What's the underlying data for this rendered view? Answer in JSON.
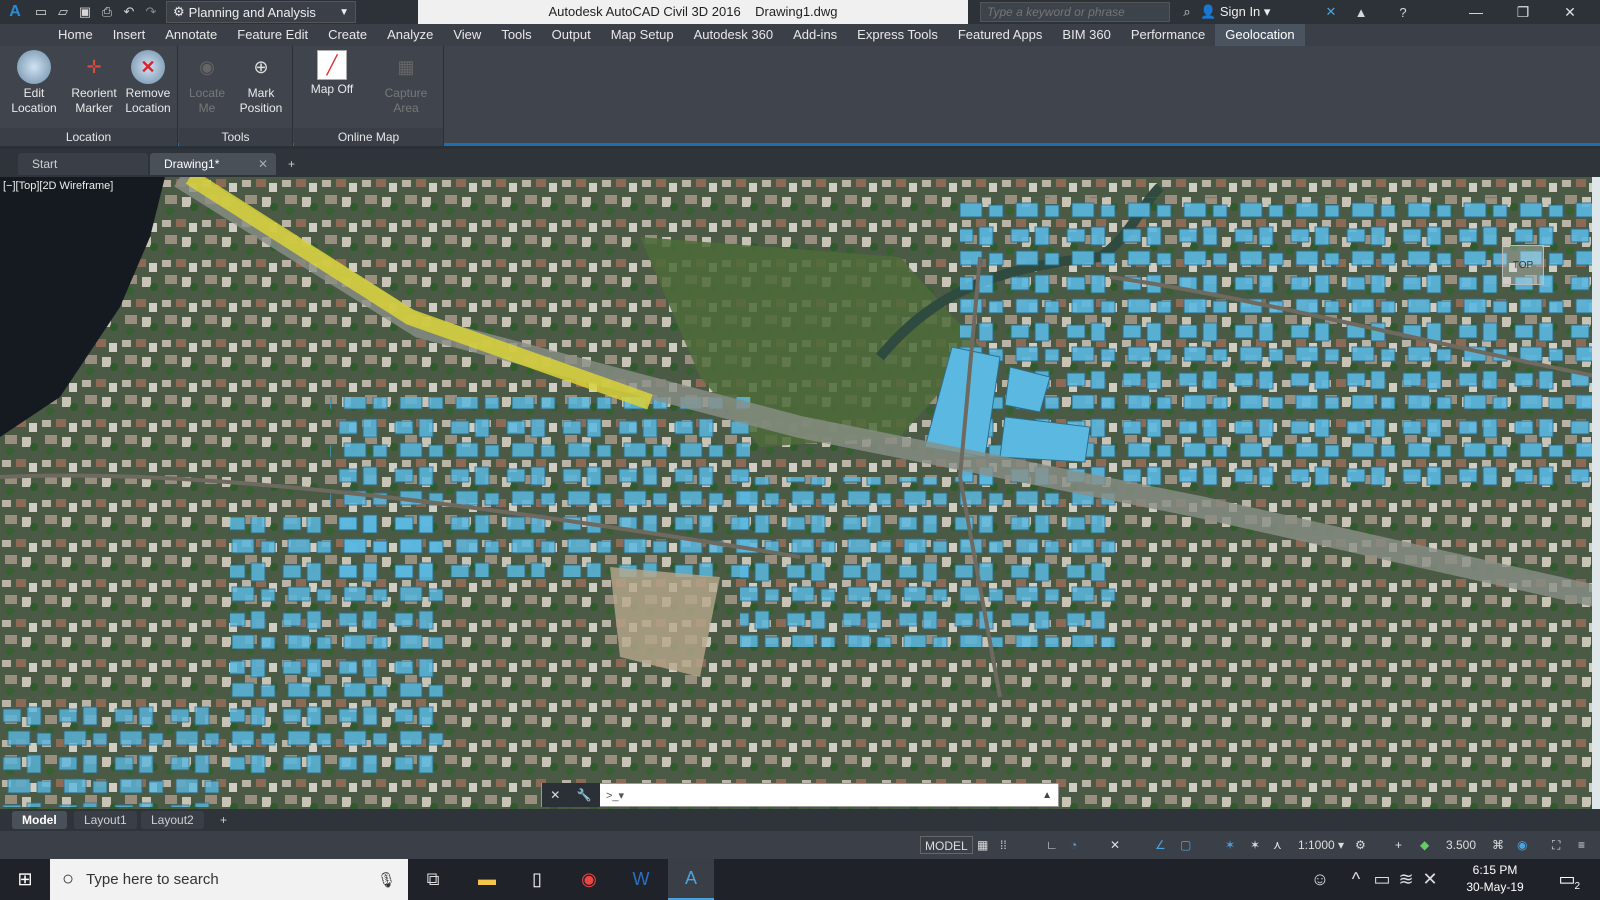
{
  "titlebar": {
    "app_icon": "autocad-logo-icon",
    "workspace": "Planning and Analysis",
    "title": "Autodesk AutoCAD Civil 3D 2016    Drawing1.dwg",
    "search_placeholder": "Type a keyword or phrase",
    "sign_in": "Sign In"
  },
  "menu": {
    "tabs": [
      "Home",
      "Insert",
      "Annotate",
      "Feature Edit",
      "Create",
      "Analyze",
      "View",
      "Tools",
      "Output",
      "Map Setup",
      "Autodesk 360",
      "Add-ins",
      "Express Tools",
      "Featured Apps",
      "BIM 360",
      "Performance",
      "Geolocation"
    ],
    "active": "Geolocation"
  },
  "ribbon": {
    "location": {
      "title": "Location",
      "edit": "Edit\nLocation",
      "reorient": "Reorient\nMarker",
      "remove": "Remove\nLocation"
    },
    "tools": {
      "title": "Tools",
      "locate": "Locate\nMe",
      "mark": "Mark\nPosition"
    },
    "online_map": {
      "title": "Online Map",
      "map_off": "Map Off",
      "capture": "Capture\nArea"
    }
  },
  "doc_tabs": {
    "start": "Start",
    "drawing": "Drawing1*"
  },
  "viewport": {
    "label": "[−][Top][2D Wireframe]",
    "viewcube": "TOP"
  },
  "layout_tabs": {
    "model": "Model",
    "layout1": "Layout1",
    "layout2": "Layout2"
  },
  "status": {
    "model": "MODEL",
    "scale": "1:1000",
    "value": "3.500"
  },
  "taskbar": {
    "search": "Type here to search",
    "time": "6:15 PM",
    "date": "30-May-19",
    "notifications": "2"
  },
  "colors": {
    "accent": "#1f6fae",
    "building": "#5bb8e0",
    "rail": "#d9d23a"
  }
}
